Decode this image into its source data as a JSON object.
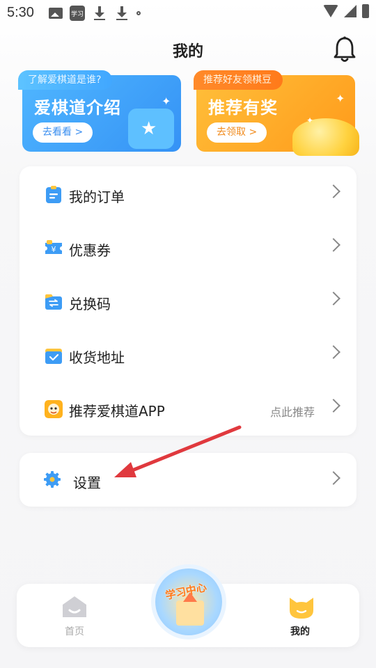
{
  "status_bar": {
    "time": "5:30",
    "app_icon_text": "学习"
  },
  "header": {
    "title": "我的"
  },
  "banners": [
    {
      "tag": "了解爱棋道是谁?",
      "title": "爱棋道介绍",
      "button": "去看看 >"
    },
    {
      "tag": "推荐好友领棋豆",
      "title": "推荐有奖",
      "button": "去领取 >"
    }
  ],
  "menu": {
    "items": [
      {
        "label": "我的订单",
        "icon": "order-icon"
      },
      {
        "label": "优惠券",
        "icon": "coupon-icon"
      },
      {
        "label": "兑换码",
        "icon": "redeem-code-icon"
      },
      {
        "label": "收货地址",
        "icon": "address-icon"
      },
      {
        "label": "推荐爱棋道APP",
        "icon": "app-logo-icon",
        "sub": "点此推荐"
      }
    ]
  },
  "settings": {
    "label": "设置",
    "icon": "gear-icon"
  },
  "bottom_nav": {
    "home": "首页",
    "center": "学习中心",
    "mine": "我的"
  },
  "colors": {
    "blue_banner": "#3a9bf7",
    "orange_banner": "#ffa424",
    "annotation_arrow": "#e0393e"
  }
}
